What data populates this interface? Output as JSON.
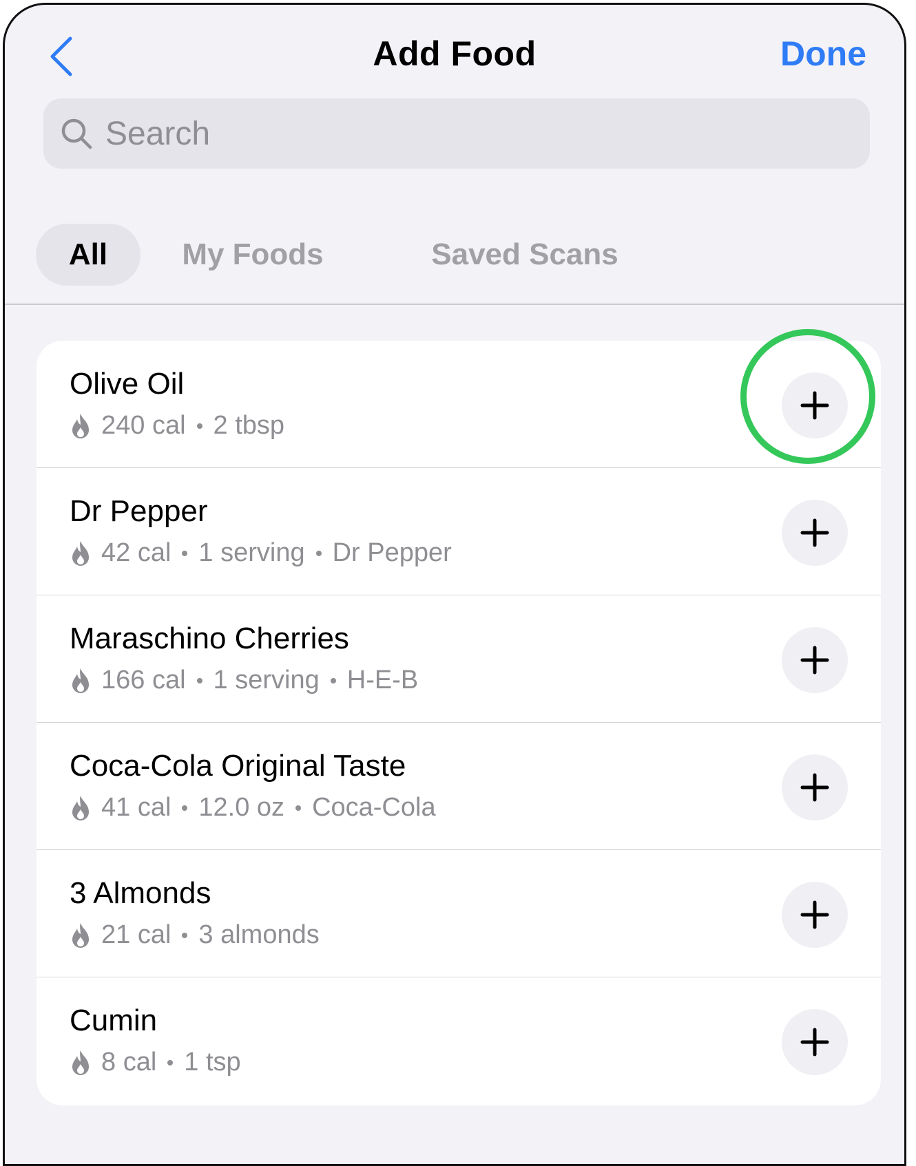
{
  "header": {
    "title": "Add Food",
    "done_label": "Done"
  },
  "search": {
    "placeholder": "Search",
    "value": ""
  },
  "tabs": [
    {
      "label": "All",
      "active": true
    },
    {
      "label": "My Foods",
      "active": false
    },
    {
      "label": "Saved Scans",
      "active": false
    }
  ],
  "foods": [
    {
      "name": "Olive Oil",
      "details": [
        "240 cal",
        "2 tbsp"
      ]
    },
    {
      "name": "Dr Pepper",
      "details": [
        "42 cal",
        "1 serving",
        "Dr Pepper"
      ]
    },
    {
      "name": "Maraschino Cherries",
      "details": [
        "166 cal",
        "1 serving",
        "H-E-B"
      ]
    },
    {
      "name": "Coca-Cola Original Taste",
      "details": [
        "41 cal",
        "12.0 oz",
        "Coca-Cola"
      ]
    },
    {
      "name": "3 Almonds",
      "details": [
        "21 cal",
        "3 almonds"
      ]
    },
    {
      "name": "Cumin",
      "details": [
        "8 cal",
        "1 tsp"
      ]
    }
  ],
  "icons": {
    "back": "chevron-left-icon",
    "search": "magnifier-icon",
    "calorie": "flame-icon",
    "add": "plus-icon"
  },
  "colors": {
    "accent": "#2f7cf6",
    "highlight": "#34c759",
    "background": "#f2f2f7",
    "secondary_text": "#8e8e93"
  }
}
